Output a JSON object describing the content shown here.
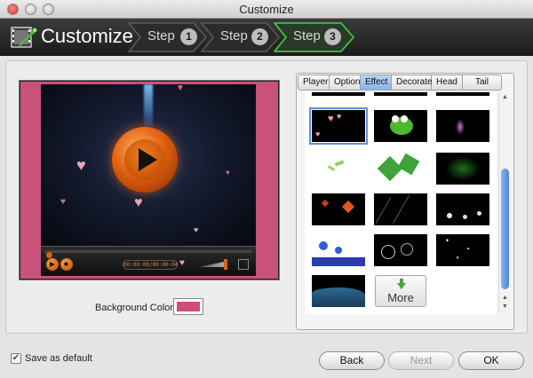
{
  "window": {
    "title": "Customize"
  },
  "header": {
    "title": "Customize",
    "steps": [
      {
        "label": "Step",
        "number": "1"
      },
      {
        "label": "Step",
        "number": "2"
      },
      {
        "label": "Step",
        "number": "3"
      }
    ],
    "active_step": 3
  },
  "preview": {
    "timecode": "00:00:00/00:00:04",
    "background_color_label": "Background Color:",
    "background_color": "#cc4f78"
  },
  "tabs": [
    {
      "label": "Player"
    },
    {
      "label": "Option"
    },
    {
      "label": "Effect",
      "active": true
    },
    {
      "label": "Decorate"
    },
    {
      "label": "Head"
    },
    {
      "label": "Tail"
    }
  ],
  "effects": {
    "more_label": "More",
    "thumbnails": [
      "hearts",
      "frog",
      "pink-sparkle",
      "leaves-small",
      "green-leaves",
      "green-drops",
      "red-leaves",
      "rain-lines",
      "white-flowers",
      "blue-flowers",
      "circles",
      "stars",
      "blue-wave"
    ]
  },
  "footer": {
    "save_default_label": "Save as default",
    "save_default_checked": true,
    "back_label": "Back",
    "next_label": "Next",
    "ok_label": "OK"
  },
  "colors": {
    "accent_active_step": "#3fbf3f",
    "selected_tab": "#8ab4e8",
    "scroll_thumb": "#4a86d8"
  }
}
